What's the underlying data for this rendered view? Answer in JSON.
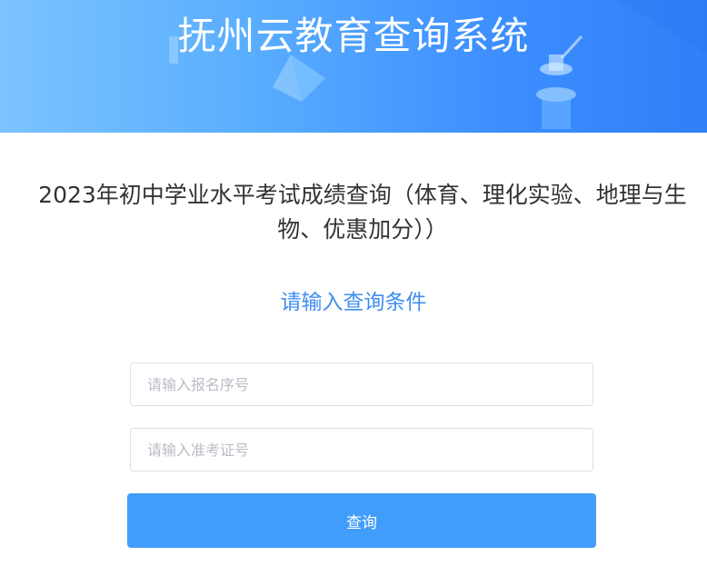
{
  "banner": {
    "title": "抚州云教育查询系统"
  },
  "main": {
    "heading": "2023年初中学业水平考试成绩查询（体育、理化实验、地理与生物、优惠加分））",
    "subheading": "请输入查询条件"
  },
  "form": {
    "registration_placeholder": "请输入报名序号",
    "registration_value": "",
    "admission_placeholder": "请输入准考证号",
    "admission_value": "",
    "submit_label": "查询"
  },
  "colors": {
    "banner_start": "#7cc3ff",
    "banner_end": "#2f7ff7",
    "accent": "#3f8ef1",
    "button": "#419dfb"
  }
}
